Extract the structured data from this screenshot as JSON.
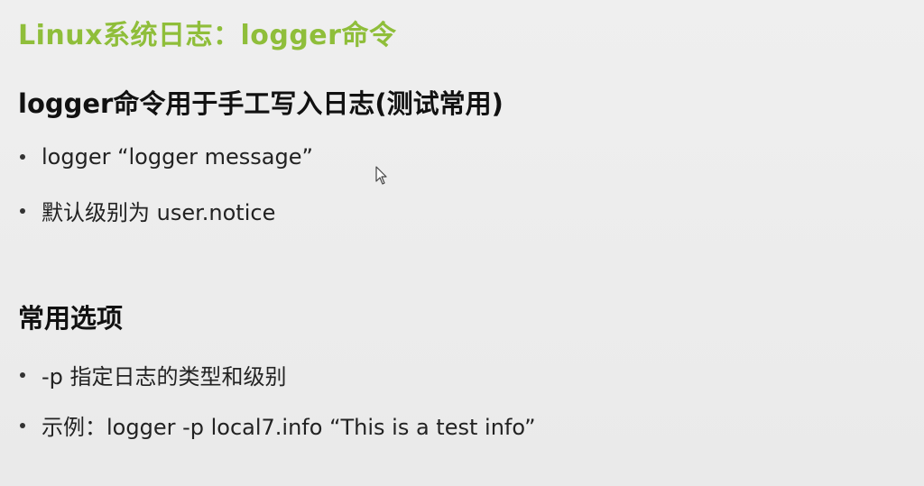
{
  "slide": {
    "title": "Linux系统日志：logger命令",
    "section1": {
      "heading": "logger命令用于手工写入日志(测试常用)",
      "bullets": [
        "logger  “logger message”",
        "默认级别为 user.notice"
      ]
    },
    "section2": {
      "heading": "常用选项",
      "bullets": [
        "-p 指定日志的类型和级别",
        "示例：logger -p local7.info  “This is a test info”"
      ]
    }
  },
  "colors": {
    "title": "#8fbe3a",
    "background": "#ececec",
    "text": "#1a1a1a"
  },
  "icons": {
    "cursor": "mouse-pointer-icon",
    "bullet": "bullet-dot-icon"
  }
}
